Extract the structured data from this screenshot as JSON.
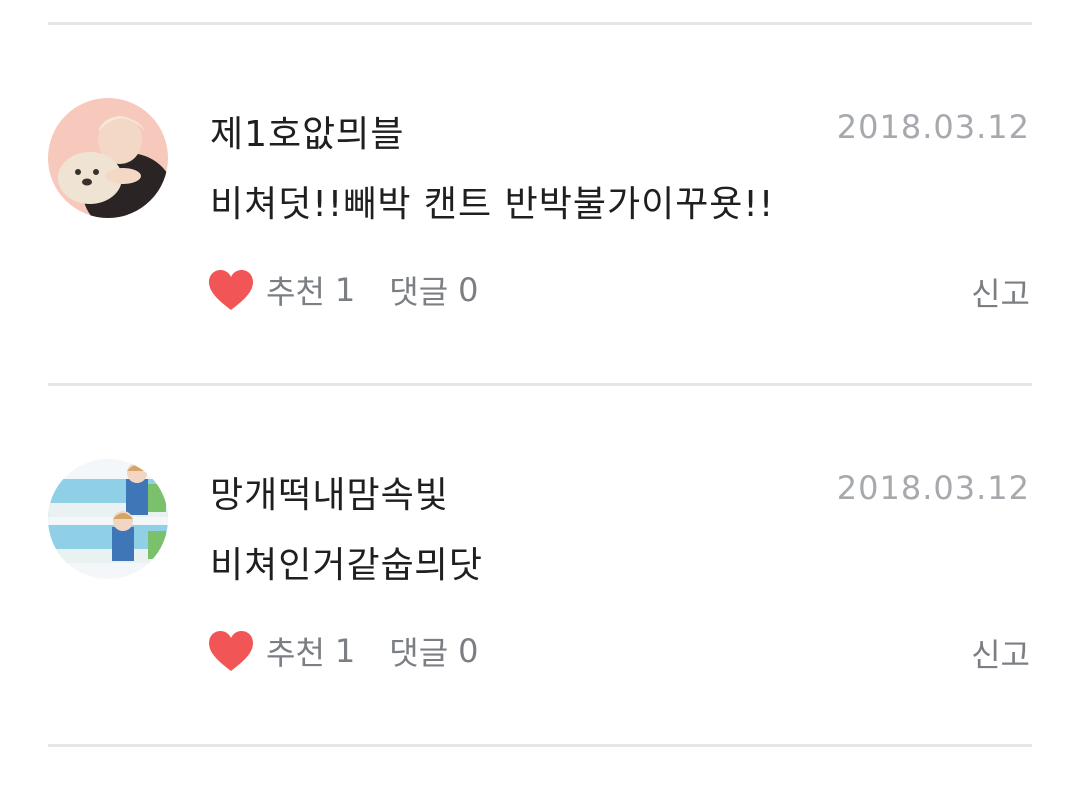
{
  "comments": [
    {
      "username": "제1호앖믜블",
      "date": "2018.03.12",
      "text": "비쳐덧!!빼박 캔트 반박불가이꾸욧!!",
      "like_label": "추천",
      "like_count": "1",
      "reply_label": "댓글",
      "reply_count": "0",
      "report_label": "신고",
      "avatar_icon": "profile-photo-person-with-plush-seal"
    },
    {
      "username": "망개떡내맘속빛",
      "date": "2018.03.12",
      "text": "비쳐인거같숩믜닷",
      "like_label": "추천",
      "like_count": "1",
      "reply_label": "댓글",
      "reply_count": "0",
      "report_label": "신고",
      "avatar_icon": "profile-photo-collage-beach"
    }
  ],
  "colors": {
    "heart": "#f25555",
    "divider": "#e6e6e6",
    "date": "#a6a9ad",
    "meta": "#7b7f84",
    "text": "#1f1f1f"
  }
}
